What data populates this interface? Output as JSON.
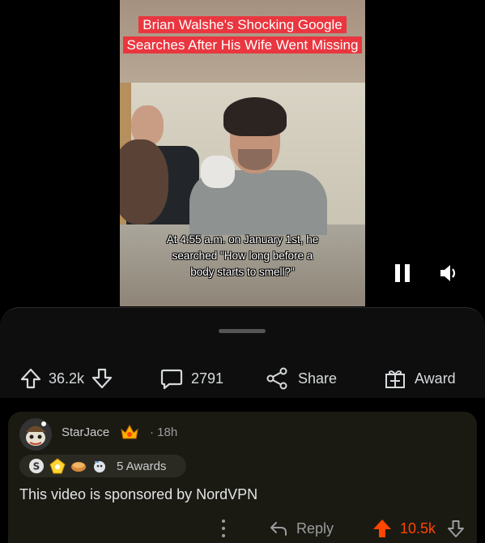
{
  "video": {
    "title": "Brian Walshe's Shocking Google Searches After His Wife Went Missing",
    "caption": "At 4:55 a.m. on January 1st, he searched \"How long before a body starts to smell?\""
  },
  "actions": {
    "upvotes": "36.2k",
    "comments": "2791",
    "share_label": "Share",
    "award_label": "Award"
  },
  "comment": {
    "username": "StarJace",
    "time": "· 18h",
    "awards_label": "5 Awards",
    "body": "This video is sponsored by NordVPN",
    "reply_label": "Reply",
    "score": "10.5k"
  },
  "colors": {
    "accent_upvote": "#ff4500",
    "title_bg": "#e9363f",
    "comment_bg": "#1b1a12"
  }
}
